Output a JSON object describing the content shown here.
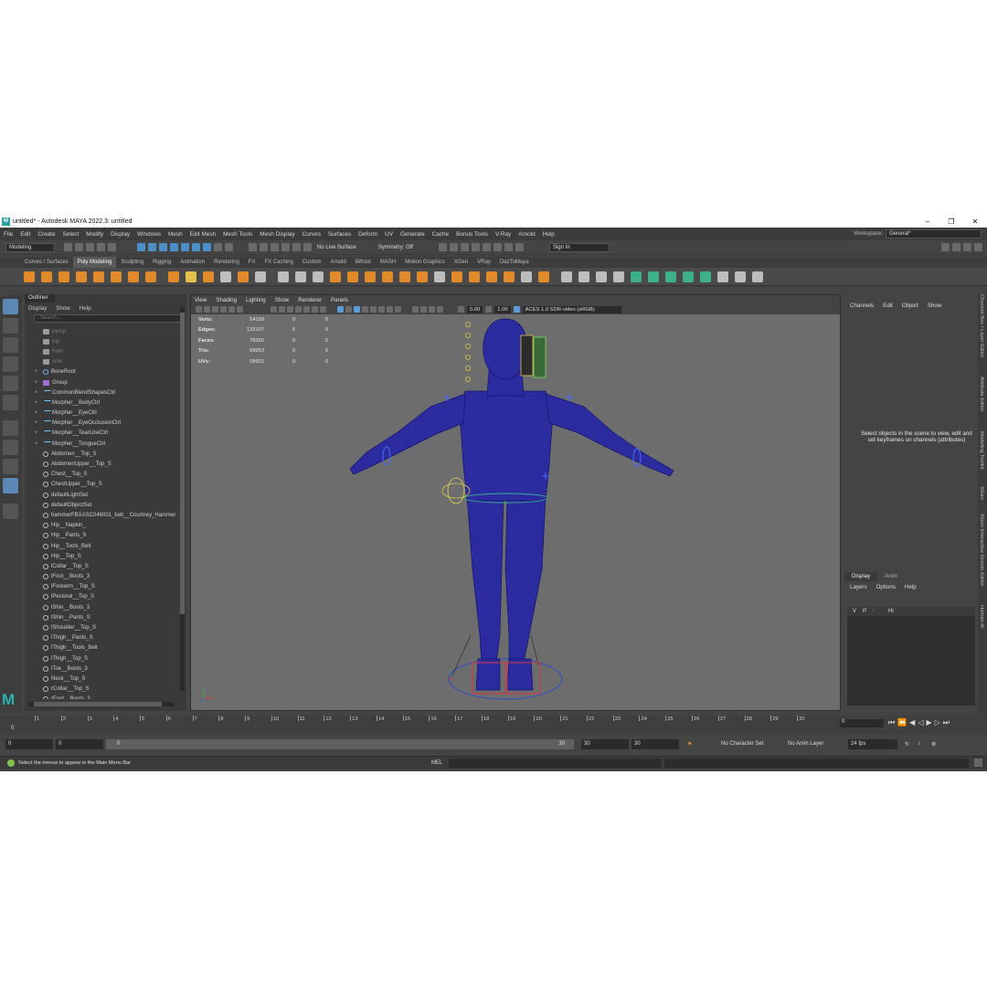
{
  "window": {
    "title": "untitled* - Autodesk MAYA 2022.3: untitled",
    "minimize": "–",
    "maximize": "❐",
    "close": "✕"
  },
  "menubar": {
    "items": [
      "File",
      "Edit",
      "Create",
      "Select",
      "Modify",
      "Display",
      "Windows",
      "Mesh",
      "Edit Mesh",
      "Mesh Tools",
      "Mesh Display",
      "Curves",
      "Surfaces",
      "Deform",
      "UV",
      "Generate",
      "Cache",
      "Bonus Tools",
      "V-Ray",
      "Arnold",
      "Help"
    ],
    "workspace_label": "Workspace:",
    "workspace_value": "General*"
  },
  "statusline": {
    "mode": "Modeling",
    "live_surface": "No Live Surface",
    "symmetry": "Symmetry: Off",
    "sign_in": "Sign In"
  },
  "shelf": {
    "tabs": [
      "Curves / Surfaces",
      "Poly Modeling",
      "Sculpting",
      "Rigging",
      "Animation",
      "Rendering",
      "FX",
      "FX Caching",
      "Custom",
      "Arnold",
      "Bifrost",
      "MASH",
      "Motion Graphics",
      "XGen",
      "VRay",
      "DazToMaya"
    ],
    "active_tab": "Poly Modeling"
  },
  "outliner": {
    "title": "Outliner",
    "menu": [
      "Display",
      "Show",
      "Help"
    ],
    "search_placeholder": "Search...",
    "items": [
      {
        "label": "persp",
        "type": "cam",
        "dim": true,
        "exp": ""
      },
      {
        "label": "top",
        "type": "cam",
        "dim": true,
        "exp": ""
      },
      {
        "label": "front",
        "type": "cam",
        "dim": true,
        "exp": ""
      },
      {
        "label": "side",
        "type": "cam",
        "dim": true,
        "exp": ""
      },
      {
        "label": "BoneRoot",
        "type": "joint",
        "dim": false,
        "exp": "+"
      },
      {
        "label": "Group",
        "type": "grp",
        "dim": false,
        "exp": "+"
      },
      {
        "label": "CommonBlendShapesCtrl",
        "type": "curve",
        "dim": false,
        "exp": "+"
      },
      {
        "label": "Morpher__BodyCtrl",
        "type": "curve",
        "dim": false,
        "exp": "+"
      },
      {
        "label": "Morpher__EyeCtrl",
        "type": "curve",
        "dim": false,
        "exp": "+"
      },
      {
        "label": "Morpher__EyeOcclusionCtrl",
        "type": "curve",
        "dim": false,
        "exp": "+"
      },
      {
        "label": "Morpher__TearLineCtrl",
        "type": "curve",
        "dim": false,
        "exp": "+"
      },
      {
        "label": "Morpher__TongueCtrl",
        "type": "curve",
        "dim": false,
        "exp": "+"
      },
      {
        "label": "Abdomen__Top_S",
        "type": "set",
        "dim": false,
        "exp": ""
      },
      {
        "label": "AbdomenUpper__Top_S",
        "type": "set",
        "dim": false,
        "exp": ""
      },
      {
        "label": "Chest__Top_S",
        "type": "set",
        "dim": false,
        "exp": ""
      },
      {
        "label": "ChestUpper__Top_S",
        "type": "set",
        "dim": false,
        "exp": ""
      },
      {
        "label": "defaultLightSet",
        "type": "set",
        "dim": false,
        "exp": ""
      },
      {
        "label": "defaultObjectSet",
        "type": "set",
        "dim": false,
        "exp": ""
      },
      {
        "label": "hammerFBXASC046001_belt__Courtney_Hammer",
        "type": "set",
        "dim": false,
        "exp": ""
      },
      {
        "label": "Hip__Napkin_",
        "type": "set",
        "dim": false,
        "exp": ""
      },
      {
        "label": "Hip__Pants_S",
        "type": "set",
        "dim": false,
        "exp": ""
      },
      {
        "label": "Hip__Tools_Belt",
        "type": "set",
        "dim": false,
        "exp": ""
      },
      {
        "label": "Hip__Top_S",
        "type": "set",
        "dim": false,
        "exp": ""
      },
      {
        "label": "lCollar__Top_S",
        "type": "set",
        "dim": false,
        "exp": ""
      },
      {
        "label": "lFoot__Boots_3",
        "type": "set",
        "dim": false,
        "exp": ""
      },
      {
        "label": "lForearm__Top_S",
        "type": "set",
        "dim": false,
        "exp": ""
      },
      {
        "label": "lPectoral__Top_S",
        "type": "set",
        "dim": false,
        "exp": ""
      },
      {
        "label": "lShin__Boots_3",
        "type": "set",
        "dim": false,
        "exp": ""
      },
      {
        "label": "lShin__Pants_S",
        "type": "set",
        "dim": false,
        "exp": ""
      },
      {
        "label": "lShoulder__Top_S",
        "type": "set",
        "dim": false,
        "exp": ""
      },
      {
        "label": "lThigh__Pants_S",
        "type": "set",
        "dim": false,
        "exp": ""
      },
      {
        "label": "lThigh__Tools_Belt",
        "type": "set",
        "dim": false,
        "exp": ""
      },
      {
        "label": "lThigh__Top_S",
        "type": "set",
        "dim": false,
        "exp": ""
      },
      {
        "label": "lToe__Boots_3",
        "type": "set",
        "dim": false,
        "exp": ""
      },
      {
        "label": "Neck__Top_S",
        "type": "set",
        "dim": false,
        "exp": ""
      },
      {
        "label": "rCollar__Top_S",
        "type": "set",
        "dim": false,
        "exp": ""
      },
      {
        "label": "rFoot__Boots_3",
        "type": "set",
        "dim": false,
        "exp": ""
      }
    ]
  },
  "viewport": {
    "menu": [
      "View",
      "Shading",
      "Lighting",
      "Show",
      "Renderer",
      "Panels"
    ],
    "exposure": "0.00",
    "gamma": "1.00",
    "color_space": "ACES 1.0 SDR-video (sRGB)",
    "hud": {
      "rows": [
        {
          "label": "Verts:",
          "v1": "54159",
          "v2": "0",
          "v3": "0"
        },
        {
          "label": "Edges:",
          "v1": "132197",
          "v2": "0",
          "v3": "0"
        },
        {
          "label": "Faces:",
          "v1": "78350",
          "v2": "0",
          "v3": "0"
        },
        {
          "label": "Tris:",
          "v1": "99953",
          "v2": "0",
          "v3": "0"
        },
        {
          "label": "UVs:",
          "v1": "58931",
          "v2": "0",
          "v3": "0"
        }
      ]
    },
    "wire_color": "#1a1aa0"
  },
  "channelbox": {
    "menu": [
      "Channels",
      "Edit",
      "Object",
      "Show"
    ],
    "message": "Select objects in the scene to view, edit and set keyframes on channels (attributes)",
    "layer_tabs": [
      "Display",
      "Anim"
    ],
    "layer_menu": [
      "Layers",
      "Options",
      "Help"
    ],
    "layer_row": {
      "v": "V",
      "p": "P",
      "name": "Hi"
    }
  },
  "side_tabs": [
    "Channel Box / Layer Editor",
    "Attribute Editor",
    "Modeling Toolkit",
    "XGen",
    "XGen Interactive Groom Editor",
    "Human IK"
  ],
  "timeline": {
    "ticks": [
      "1",
      "2",
      "3",
      "4",
      "5",
      "6",
      "7",
      "8",
      "9",
      "10",
      "11",
      "12",
      "13",
      "14",
      "15",
      "16",
      "17",
      "18",
      "19",
      "20",
      "21",
      "22",
      "23",
      "24",
      "25",
      "26",
      "27",
      "28",
      "29",
      "30"
    ],
    "current_frame": "0",
    "start_of_row": "0"
  },
  "range": {
    "start": "0",
    "inner_start": "0",
    "slider_start": "0",
    "slider_end": "30",
    "inner_end": "30",
    "end": "30",
    "character_set": "No Character Set",
    "anim_layer": "No Anim Layer",
    "fps": "24 fps"
  },
  "commandline": {
    "help": "Select the menus to appear in the Main Menu Bar",
    "mel": "MEL"
  }
}
